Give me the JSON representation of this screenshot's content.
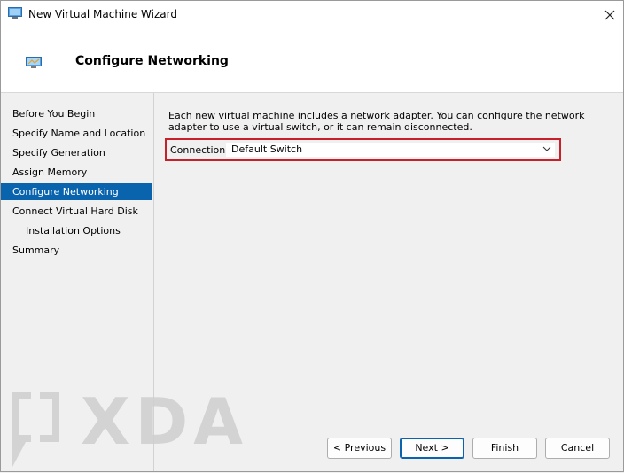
{
  "window": {
    "title": "New Virtual Machine Wizard",
    "close_icon": "close-icon",
    "icon": "virtual-machine-icon"
  },
  "header": {
    "title": "Configure Networking",
    "icon": "network-monitor-icon"
  },
  "sidebar": {
    "items": [
      {
        "label": "Before You Begin",
        "active": false
      },
      {
        "label": "Specify Name and Location",
        "active": false
      },
      {
        "label": "Specify Generation",
        "active": false
      },
      {
        "label": "Assign Memory",
        "active": false
      },
      {
        "label": "Configure Networking",
        "active": true
      },
      {
        "label": "Connect Virtual Hard Disk",
        "active": false
      },
      {
        "label": "Installation Options",
        "active": false
      },
      {
        "label": "Summary",
        "active": false
      }
    ]
  },
  "content": {
    "description": "Each new virtual machine includes a network adapter. You can configure the network adapter to use a virtual switch, or it can remain disconnected.",
    "connection_label": "Connection:",
    "connection_value": "Default Switch",
    "highlight_color": "#c8202b"
  },
  "buttons": {
    "previous": "< Previous",
    "next": "Next >",
    "finish": "Finish",
    "cancel": "Cancel"
  },
  "watermark": {
    "text": "XDA"
  },
  "colors": {
    "accent": "#0a64ad"
  }
}
